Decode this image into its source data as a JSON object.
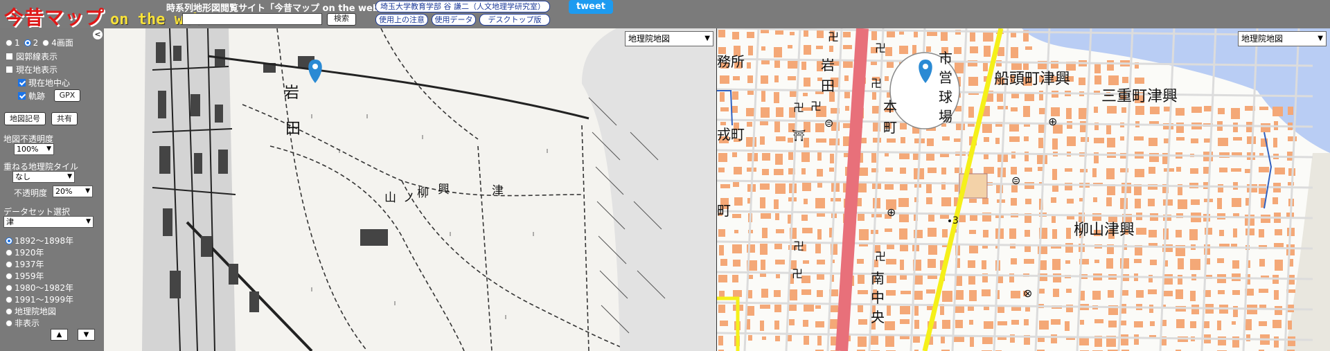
{
  "header": {
    "logo_main": "今昔マップ",
    "logo_sub": "on the web",
    "site_desc": "時系列地形図閲覧サイト「今昔マップ on the web」",
    "search_placeholder": "",
    "search_button": "検索",
    "affiliation": "埼玉大学教育学部 谷 謙二（人文地理学研究室）",
    "usage_notes": "使用上の注意",
    "data_used": "使用データ",
    "desktop": "デスクトップ版",
    "tweet": "tweet"
  },
  "sidebar": {
    "collapse": "<",
    "screen_options": [
      "1",
      "2",
      "4画面"
    ],
    "selected_screen": "2",
    "outline_label": "図郭線表示",
    "current_loc_label": "現在地表示",
    "current_center_label": "現在地中心",
    "track_label": "軌跡",
    "gpx_button": "GPX",
    "map_symbols_button": "地図記号",
    "share_button": "共有",
    "opacity_label": "地図不透明度",
    "opacity_value": "100%",
    "overlay_label": "重ねる地理院タイル",
    "overlay_value": "なし",
    "overlay_opacity_label": "不透明度",
    "overlay_opacity_value": "20%",
    "dataset_label": "データセット選択",
    "dataset_value": "津",
    "periods": [
      "1892～1898年",
      "1920年",
      "1937年",
      "1959年",
      "1980～1982年",
      "1991～1999年",
      "地理院地図",
      "非表示"
    ],
    "selected_period": "1892～1898年",
    "up_button": "▲",
    "down_button": "▼"
  },
  "map_old": {
    "layer_select": "地理院地図",
    "labels": [
      "岩",
      "田",
      "山",
      "ノ",
      "柳",
      "興",
      "津"
    ]
  },
  "map_new": {
    "layer_select": "地理院地図",
    "labels": [
      "岩",
      "田",
      "本",
      "町",
      "市",
      "営",
      "球",
      "場",
      "船頭町津興",
      "三重町津興",
      "柳山津興",
      "南",
      "中",
      "央",
      "務所",
      "戎町",
      "町",
      "3"
    ]
  },
  "colors": {
    "header_bg": "#7b7b7b",
    "logo_red": "#e01818",
    "logo_yellow": "#f7e13a",
    "tweet_blue": "#1d9bf0",
    "road_red": "#e8707a",
    "road_yellow": "#f5f019",
    "river_blue": "#b9cdf4",
    "building_orange": "#f4a877"
  },
  "icons": [
    "map-marker-icon",
    "temple-icon",
    "school-icon",
    "police-icon",
    "shrine-icon",
    "post-office-icon"
  ]
}
